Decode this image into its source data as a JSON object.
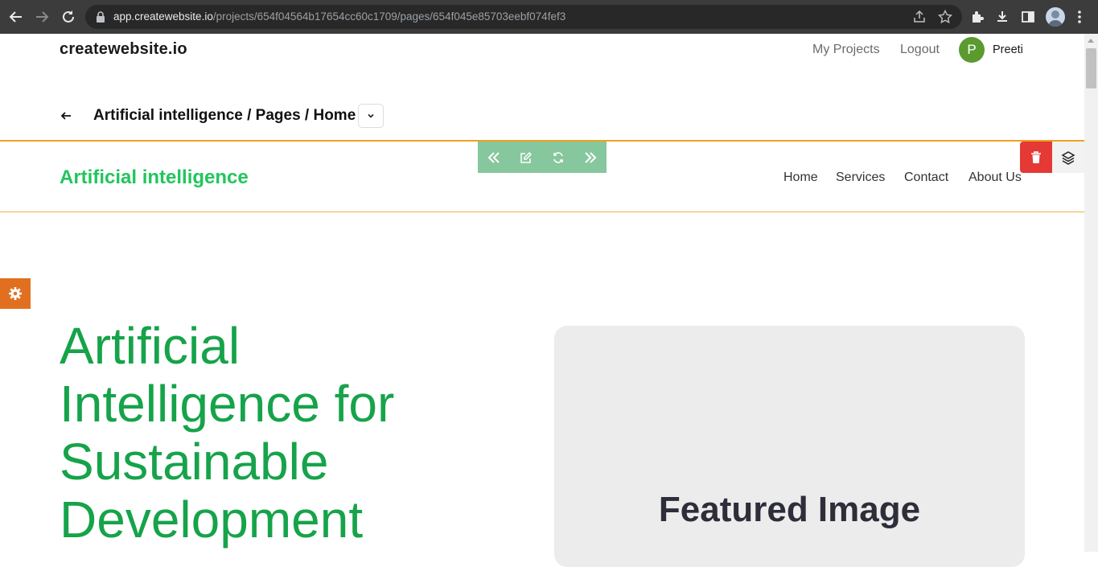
{
  "browser": {
    "url_host": "app.createwebsite.io",
    "url_path": "/projects/654f04564b17654cc60c1709/pages/654f045e85703eebf074fef3"
  },
  "app": {
    "brand": "createwebsite.io",
    "nav": {
      "projects": "My Projects",
      "logout": "Logout"
    },
    "user": {
      "initial": "P",
      "name": "Preeti"
    },
    "breadcrumb": "Artificial intelligence / Pages / Home"
  },
  "site": {
    "title": "Artificial intelligence",
    "nav": [
      "Home",
      "Services",
      "Contact",
      "About Us"
    ],
    "hero_title": "Artificial Intelligence for Sustainable Development",
    "featured_label": "Featured Image"
  },
  "colors": {
    "site_accent": "#22c55e",
    "hero_text": "#16a34a",
    "toolbar": "#86c79e",
    "delete": "#e53935",
    "settings": "#e07020",
    "avatar": "#5a9a2f"
  }
}
